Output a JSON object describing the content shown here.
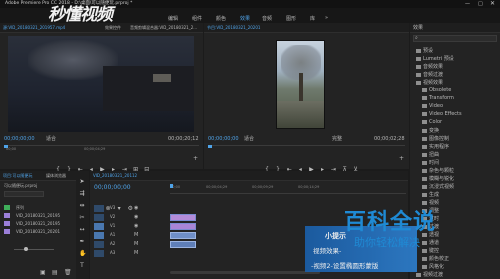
{
  "app": {
    "title": "Adobe Premiere Pro CC 2018 - D:\\桌面\\可以随便玩.prproj *"
  },
  "menu": {
    "items": [
      "编辑",
      "组件",
      "颜色",
      "效果",
      "音频",
      "图形",
      "库"
    ],
    "active_index": 3,
    "overflow": "»"
  },
  "source_panel": {
    "tab": "源:VID_20180321_201957.mp4",
    "tab2": "效果控件",
    "tab3": "音频剪辑混合器:VID_20180321_2...",
    "timecode": "00;00;00;00",
    "zoom": "适合",
    "duration": "00;00;20;12",
    "ruler_ticks": [
      "00;00",
      "00;00;04;29"
    ]
  },
  "program_panel": {
    "tab": "节目:VID_20180321_20201",
    "timecode": "00;00;00;00",
    "zoom": "适合",
    "fraction": "完整",
    "duration": "00;00;02;28"
  },
  "effects_panel": {
    "tab": "效果",
    "items": [
      "预设",
      "Lumetri 预设",
      "音频效果",
      "音频过渡",
      "视频效果",
      "Obsolete",
      "Transform",
      "Video",
      "Video Effects",
      "Color",
      "变换",
      "图像控制",
      "实用程序",
      "扭曲",
      "时间",
      "杂色与颗粒",
      "模糊与锐化",
      "沉浸式视频",
      "生成",
      "视频",
      "调整",
      "过时",
      "过渡",
      "透视",
      "通道",
      "键控",
      "颜色校正",
      "风格化",
      "视频过渡"
    ]
  },
  "project_panel": {
    "tab": "项目:可以随便玩",
    "subtab": "媒体浏览器",
    "file": "可以随便玩.prproj",
    "items": [
      "序列",
      "VID_20180321_20195",
      "VID_20180321_20195",
      "VID_20180321_20201"
    ]
  },
  "timeline": {
    "tab": "VID_20180321_20112",
    "timecode": "00;00;00;00",
    "ruler": [
      "00;00",
      "00;00;04;29",
      "00;00;09;29",
      "00;00;14;29"
    ],
    "tracks": [
      "V3",
      "V2",
      "V1",
      "A1",
      "A2",
      "A3"
    ]
  },
  "caption": {
    "line1": "小提示",
    "line2": "视频效果-",
    "line3": "-视频2-设置椭圆形蒙版"
  },
  "watermark": {
    "title": "百科全说",
    "subtitle": "助你轻松解决"
  },
  "logo_text": "秒懂视频"
}
